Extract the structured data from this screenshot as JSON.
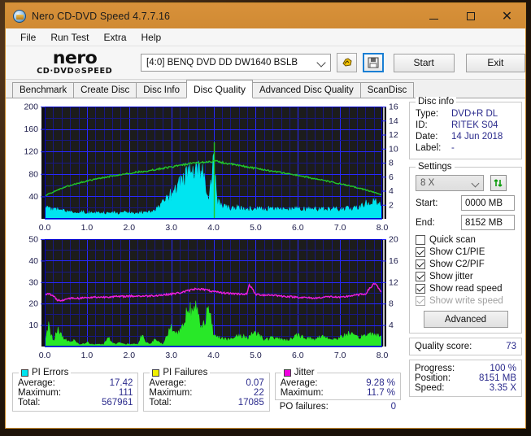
{
  "window": {
    "title": "Nero CD-DVD Speed 4.7.7.16",
    "icon": "nero-app-icon",
    "minimize_label": "minimize",
    "maximize_label": "maximize",
    "close_label": "✕"
  },
  "menu": {
    "items": [
      "File",
      "Run Test",
      "Extra",
      "Help"
    ]
  },
  "toolbar": {
    "logo_main": "nero",
    "logo_sub": "CD·DVD⊘SPEED",
    "drive": "[4:0]   BENQ DVD DD DW1640 BSLB",
    "eject_icon": "eject-hand-icon",
    "save_icon": "floppy-save-icon",
    "start_label": "Start",
    "exit_label": "Exit"
  },
  "tabs": [
    {
      "label": "Benchmark",
      "active": false
    },
    {
      "label": "Create Disc",
      "active": false
    },
    {
      "label": "Disc Info",
      "active": false
    },
    {
      "label": "Disc Quality",
      "active": true
    },
    {
      "label": "Advanced Disc Quality",
      "active": false
    },
    {
      "label": "ScanDisc",
      "active": false
    }
  ],
  "disc_info": {
    "legend": "Disc info",
    "rows": [
      {
        "label": "Type:",
        "value": "DVD+R DL"
      },
      {
        "label": "ID:",
        "value": "RITEK S04"
      },
      {
        "label": "Date:",
        "value": "14 Jun 2018"
      },
      {
        "label": "Label:",
        "value": "-"
      }
    ]
  },
  "settings": {
    "legend": "Settings",
    "speed": "8 X",
    "refresh_icon": "refresh-arrows-icon",
    "start_label": "Start:",
    "start_value": "0000 MB",
    "end_label": "End:",
    "end_value": "8152 MB",
    "checkboxes": [
      {
        "label": "Quick scan",
        "checked": false,
        "disabled": false
      },
      {
        "label": "Show C1/PIE",
        "checked": true,
        "disabled": false
      },
      {
        "label": "Show C2/PIF",
        "checked": true,
        "disabled": false
      },
      {
        "label": "Show jitter",
        "checked": true,
        "disabled": false
      },
      {
        "label": "Show read speed",
        "checked": true,
        "disabled": false
      },
      {
        "label": "Show write speed",
        "checked": true,
        "disabled": true
      }
    ],
    "advanced_label": "Advanced"
  },
  "quality": {
    "label": "Quality score:",
    "value": "73"
  },
  "progress": {
    "rows": [
      {
        "label": "Progress:",
        "value": "100 %"
      },
      {
        "label": "Position:",
        "value": "8151 MB"
      },
      {
        "label": "Speed:",
        "value": "3.35 X"
      }
    ]
  },
  "stats": {
    "pi_errors": {
      "legend": "PI Errors",
      "color": "#00e5f0",
      "rows": [
        {
          "label": "Average:",
          "value": "17.42"
        },
        {
          "label": "Maximum:",
          "value": "111"
        },
        {
          "label": "Total:",
          "value": "567961"
        }
      ]
    },
    "pi_failures": {
      "legend": "PI Failures",
      "color": "#f0f000",
      "rows": [
        {
          "label": "Average:",
          "value": "0.07"
        },
        {
          "label": "Maximum:",
          "value": "22"
        },
        {
          "label": "Total:",
          "value": "17085"
        }
      ]
    },
    "jitter": {
      "legend": "Jitter",
      "color": "#f000e0",
      "rows": [
        {
          "label": "Average:",
          "value": "9.28 %"
        },
        {
          "label": "Maximum:",
          "value": "11.7 %"
        }
      ],
      "po_label": "PO failures:",
      "po_value": "0"
    }
  },
  "chart_data": [
    {
      "type": "area",
      "name": "PI Errors / read speed",
      "title": "",
      "xlabel": "",
      "ylabel": "PI Errors",
      "xlim": [
        0.0,
        8.0
      ],
      "ylim": [
        0,
        200
      ],
      "y2lim": [
        0,
        16
      ],
      "xticks": [
        "0.0",
        "1.0",
        "2.0",
        "3.0",
        "4.0",
        "5.0",
        "6.0",
        "7.0",
        "8.0"
      ],
      "yticks": [
        "40",
        "80",
        "120",
        "160",
        "200"
      ],
      "y2ticks": [
        "2",
        "4",
        "6",
        "8",
        "10",
        "12",
        "14",
        "16"
      ],
      "grid": true,
      "legend_position": "below-external",
      "series": [
        {
          "name": "PI Errors",
          "kind": "area",
          "color": "#00e5f0",
          "x": [
            0.0,
            0.1,
            0.2,
            0.3,
            0.4,
            0.5,
            0.6,
            0.7,
            0.8,
            0.9,
            1.0,
            1.1,
            1.2,
            1.3,
            1.4,
            1.5,
            1.6,
            1.7,
            1.8,
            1.9,
            2.0,
            2.1,
            2.2,
            2.3,
            2.4,
            2.5,
            2.6,
            2.7,
            2.8,
            2.9,
            3.0,
            3.1,
            3.2,
            3.3,
            3.4,
            3.5,
            3.6,
            3.7,
            3.8,
            3.9,
            4.0,
            4.1,
            4.2,
            4.3,
            4.4,
            4.5,
            4.6,
            4.7,
            4.8,
            4.9,
            5.0,
            5.2,
            5.4,
            5.6,
            5.8,
            6.0,
            6.2,
            6.4,
            6.6,
            6.8,
            7.0,
            7.2,
            7.4,
            7.6,
            7.8,
            8.0
          ],
          "values": [
            30,
            18,
            15,
            16,
            20,
            14,
            12,
            12,
            11,
            12,
            11,
            10,
            10,
            10,
            10,
            10,
            11,
            10,
            10,
            11,
            11,
            10,
            10,
            11,
            12,
            12,
            14,
            20,
            28,
            36,
            44,
            55,
            66,
            74,
            82,
            88,
            98,
            84,
            66,
            30,
            104,
            30,
            22,
            20,
            19,
            20,
            19,
            18,
            18,
            19,
            18,
            18,
            18,
            17,
            17,
            17,
            17,
            17,
            17,
            17,
            17,
            18,
            20,
            26,
            30,
            26
          ]
        },
        {
          "name": "read speed",
          "kind": "line",
          "color": "#22c52a",
          "axis": "right",
          "x": [
            0.0,
            0.5,
            1.0,
            1.5,
            2.0,
            2.5,
            3.0,
            3.5,
            4.0,
            4.05,
            4.5,
            5.0,
            5.5,
            6.0,
            6.5,
            7.0,
            7.5,
            7.8,
            8.0
          ],
          "values": [
            3.3,
            4.6,
            5.4,
            6.0,
            6.5,
            6.9,
            7.4,
            7.9,
            8.2,
            8.2,
            7.7,
            7.2,
            6.7,
            6.2,
            5.6,
            5.0,
            4.3,
            3.8,
            3.4
          ]
        }
      ]
    },
    {
      "type": "area",
      "name": "PI Failures / jitter",
      "title": "",
      "xlabel": "",
      "ylabel": "PI Failures",
      "xlim": [
        0.0,
        8.0
      ],
      "ylim": [
        0,
        50
      ],
      "y2lim": [
        0,
        20
      ],
      "xticks": [
        "0.0",
        "1.0",
        "2.0",
        "3.0",
        "4.0",
        "5.0",
        "6.0",
        "7.0",
        "8.0"
      ],
      "yticks": [
        "10",
        "20",
        "30",
        "40",
        "50"
      ],
      "y2ticks": [
        "4",
        "8",
        "12",
        "16",
        "20"
      ],
      "grid": true,
      "legend_position": "below-external",
      "series": [
        {
          "name": "PI Failures",
          "kind": "area",
          "color": "#28e828",
          "x": [
            0.0,
            0.1,
            0.2,
            0.3,
            0.4,
            0.5,
            0.6,
            0.7,
            0.8,
            0.9,
            1.0,
            1.1,
            1.2,
            1.3,
            1.4,
            1.5,
            1.6,
            1.7,
            1.8,
            1.9,
            2.0,
            2.1,
            2.2,
            2.3,
            2.4,
            2.5,
            2.6,
            2.7,
            2.8,
            2.9,
            3.0,
            3.1,
            3.2,
            3.3,
            3.4,
            3.5,
            3.6,
            3.7,
            3.8,
            3.9,
            4.0,
            4.2,
            4.4,
            4.6,
            4.8,
            5.0,
            5.2,
            5.4,
            5.6,
            5.8,
            6.0,
            6.2,
            6.4,
            6.6,
            6.8,
            7.0,
            7.2,
            7.4,
            7.6,
            7.8,
            8.0
          ],
          "values": [
            1,
            10,
            2,
            8,
            5,
            3,
            2,
            3,
            1,
            1,
            2,
            1,
            1,
            1,
            1,
            4,
            2,
            1,
            2,
            1,
            1,
            1,
            1,
            5,
            2,
            1,
            3,
            2,
            1,
            5,
            9,
            6,
            7,
            11,
            20,
            14,
            18,
            9,
            13,
            17,
            5,
            4,
            3,
            5,
            4,
            7,
            3,
            4,
            3,
            3,
            5,
            4,
            3,
            5,
            3,
            4,
            6,
            4,
            5,
            6,
            4
          ]
        },
        {
          "name": "jitter",
          "kind": "line",
          "color": "#f11ee0",
          "axis": "right",
          "x": [
            0.0,
            0.1,
            0.2,
            0.3,
            0.4,
            0.5,
            0.6,
            0.8,
            1.0,
            1.2,
            1.4,
            1.6,
            1.8,
            2.0,
            2.2,
            2.4,
            2.6,
            2.8,
            3.0,
            3.2,
            3.4,
            3.6,
            3.8,
            4.0,
            4.2,
            4.4,
            4.6,
            4.8,
            4.85,
            5.0,
            5.2,
            5.4,
            5.6,
            5.8,
            6.0,
            6.2,
            6.4,
            6.6,
            6.8,
            7.0,
            7.2,
            7.4,
            7.6,
            7.8,
            7.85,
            8.0
          ],
          "values": [
            9.6,
            9.8,
            9.5,
            8.6,
            8.6,
            8.8,
            9.0,
            9.0,
            9.1,
            9.2,
            9.2,
            9.3,
            9.3,
            9.4,
            9.4,
            9.4,
            9.5,
            9.6,
            9.8,
            10.0,
            10.4,
            10.8,
            10.6,
            10.2,
            10.0,
            9.9,
            9.8,
            9.8,
            11.6,
            9.7,
            9.6,
            9.6,
            9.4,
            9.3,
            9.2,
            9.1,
            9.0,
            9.2,
            9.3,
            9.1,
            9.4,
            9.6,
            9.8,
            11.7,
            11.7,
            9.8
          ]
        }
      ]
    }
  ]
}
